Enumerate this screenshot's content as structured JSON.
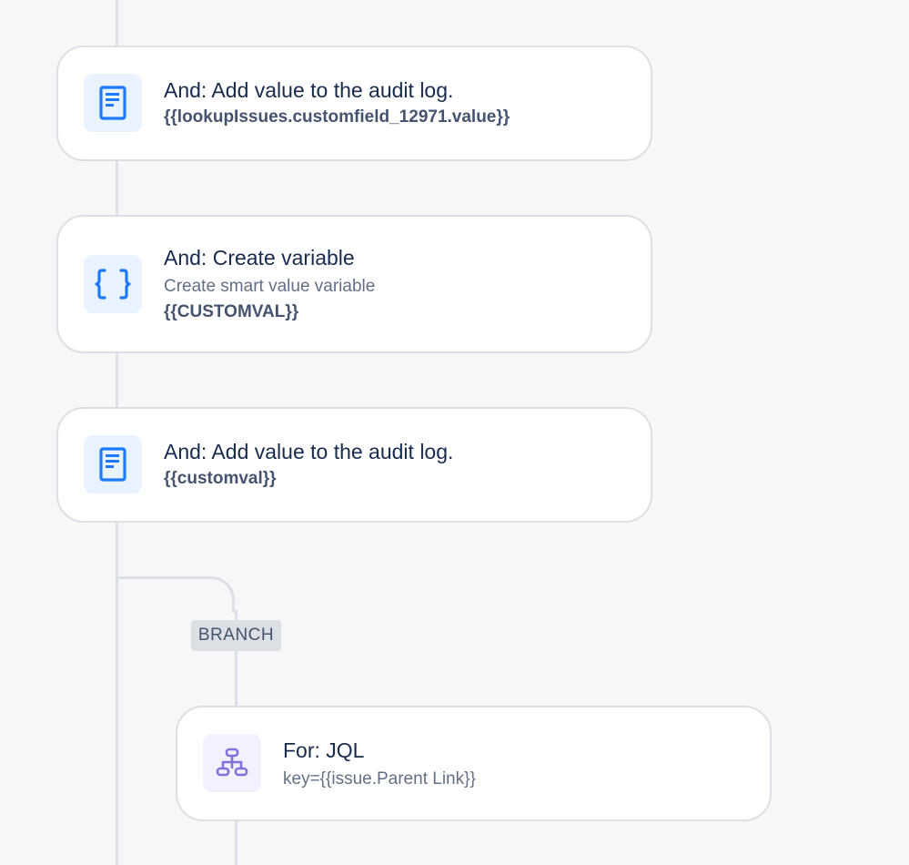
{
  "cards": [
    {
      "icon": "document-icon",
      "title": "And: Add value to the audit log.",
      "value": "{{lookupIssues.customfield_12971.value}}"
    },
    {
      "icon": "braces-icon",
      "title": "And: Create variable",
      "subtitle": "Create smart value variable",
      "value": "{{CUSTOMVAL}}"
    },
    {
      "icon": "document-icon",
      "title": "And: Add value to the audit log.",
      "value": "{{customval}}"
    }
  ],
  "branch": {
    "label": "BRANCH",
    "card": {
      "icon": "branch-hierarchy-icon",
      "title": "For: JQL",
      "subtitle": "key={{issue.Parent Link}}"
    }
  },
  "colors": {
    "accent_blue": "#1d7afc",
    "icon_bg_blue": "#e9f2ff",
    "accent_purple": "#8270db",
    "icon_bg_purple": "#f3f0ff",
    "connector": "#dcdfe4",
    "background": "#f6f7f9"
  }
}
